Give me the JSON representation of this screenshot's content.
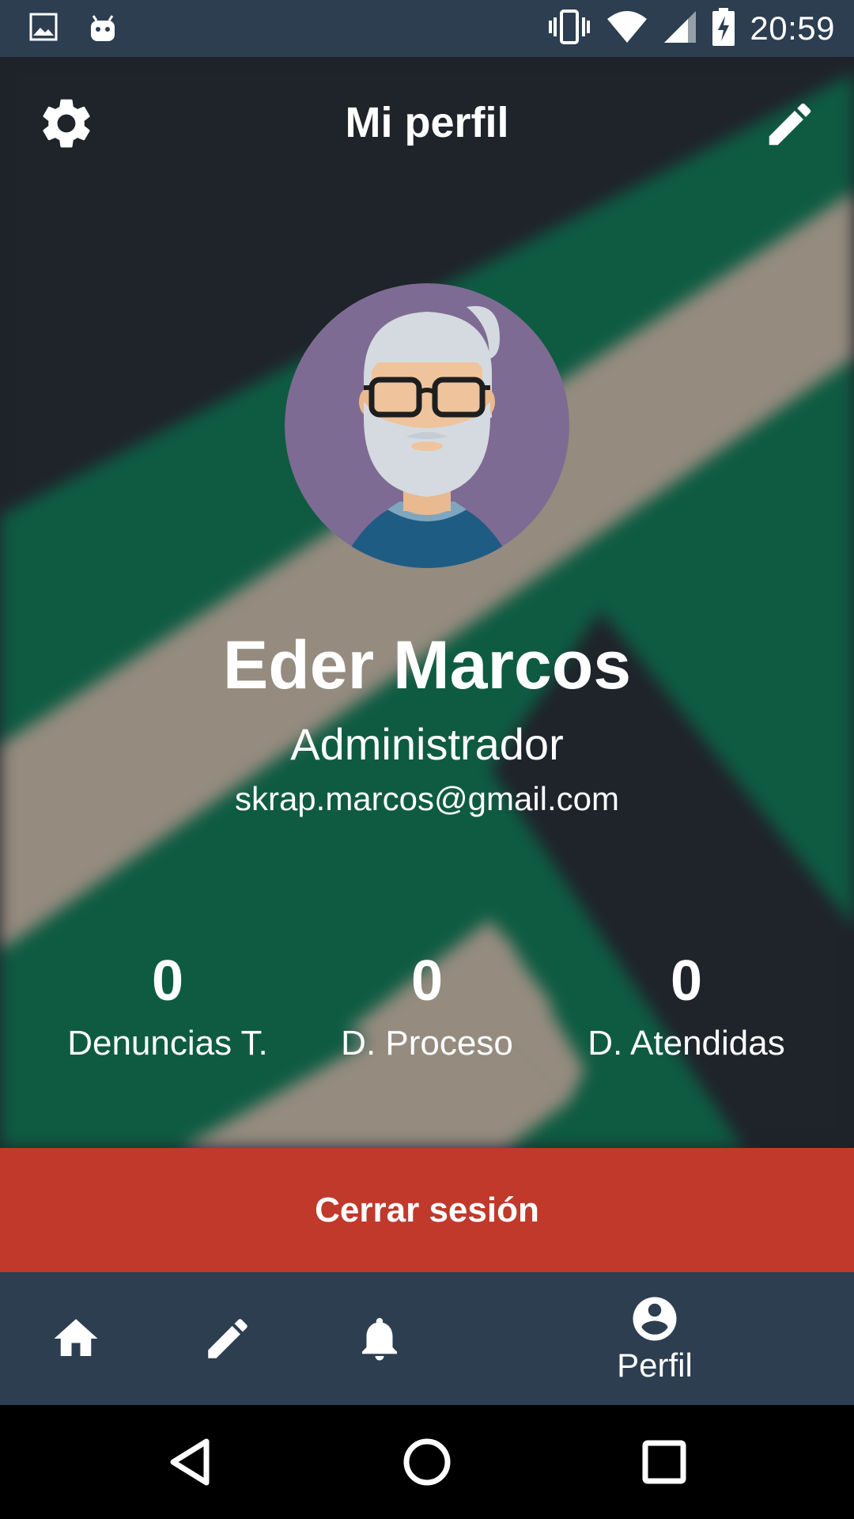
{
  "status_bar": {
    "time": "20:59",
    "left_icons": [
      "image-icon",
      "android-icon"
    ],
    "right_icons": [
      "vibrate-icon",
      "wifi-icon",
      "signal-icon",
      "battery-charging-icon"
    ]
  },
  "app_bar": {
    "title": "Mi perfil",
    "left_icon": "settings-icon",
    "right_icon": "edit-icon"
  },
  "profile": {
    "name": "Eder Marcos",
    "role": "Administrador",
    "email": "skrap.marcos@gmail.com"
  },
  "stats": [
    {
      "value": "0",
      "label": "Denuncias T."
    },
    {
      "value": "0",
      "label": "D. Proceso"
    },
    {
      "value": "0",
      "label": "D. Atendidas"
    }
  ],
  "logout": {
    "label": "Cerrar sesión",
    "color": "#c0392b"
  },
  "bottom_nav": {
    "items": [
      {
        "icon": "home-icon",
        "label": ""
      },
      {
        "icon": "pencil-icon",
        "label": ""
      },
      {
        "icon": "bell-icon",
        "label": ""
      },
      {
        "icon": "account-circle-icon",
        "label": "Perfil"
      }
    ],
    "active_index": 3
  },
  "system_nav": {
    "buttons": [
      "back-icon",
      "home-circle-icon",
      "recents-icon"
    ]
  },
  "colors": {
    "primary_dark": "#2c3e50",
    "hero_dark": "#1f232a",
    "hero_green": "#0e5b42",
    "hero_beige": "#958b7f",
    "accent_red": "#c0392b"
  }
}
